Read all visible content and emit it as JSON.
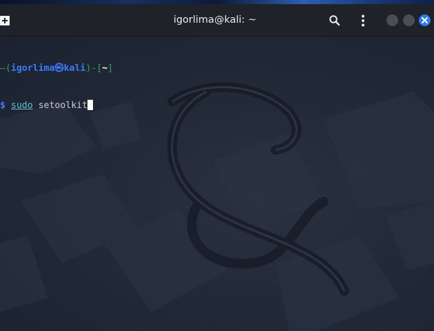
{
  "window": {
    "title": "igorlima@kali: ~"
  },
  "icons": {
    "new_tab": "new-tab-icon",
    "search": "search-icon",
    "menu": "kebab-menu-icon",
    "minimize": "minimize-icon",
    "maximize": "maximize-icon",
    "close": "close-icon"
  },
  "colors": {
    "prompt_frame": "#2fa84f",
    "prompt_user_host": "#3d7bff",
    "prompt_dir": "#ffffff",
    "command_sudo": "#5fc2d6",
    "close_button": "#2b7de9",
    "background": "#1c2330"
  },
  "terminal": {
    "prompt": {
      "frame_open": "—(",
      "user": "igorlima",
      "at_symbol": "㉿",
      "host": "kali",
      "frame_mid": ")-[",
      "cwd": "~",
      "frame_close": "]",
      "dollar": "$ "
    },
    "command": {
      "sudo": "sudo",
      "space": " ",
      "program": "setoolkit"
    }
  }
}
